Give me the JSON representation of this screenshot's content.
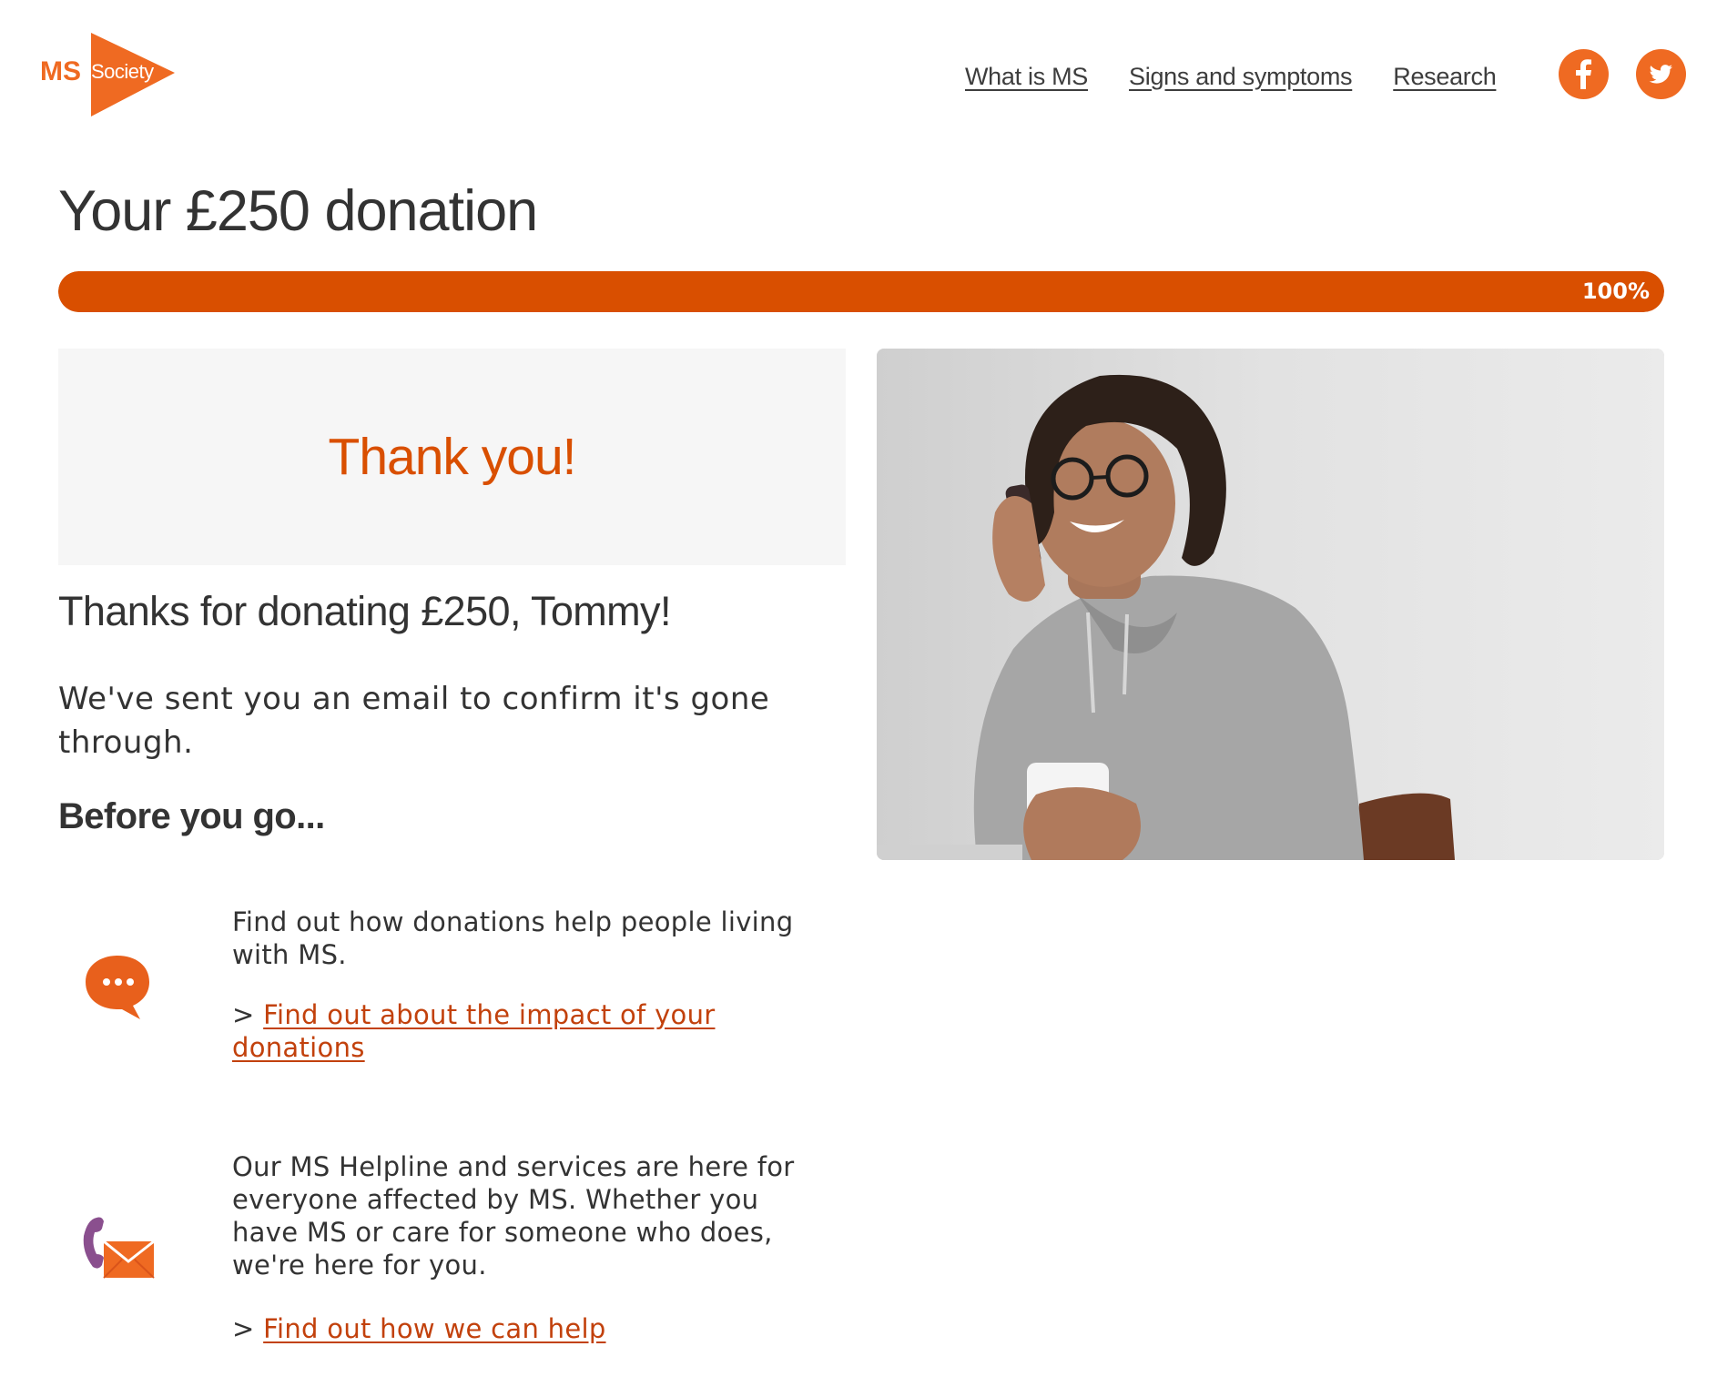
{
  "brand": {
    "logo_ms": "MS",
    "logo_society": "Society",
    "accent": "#d94f00",
    "link_color": "#c2410c"
  },
  "nav": {
    "items": [
      "What is MS",
      "Signs and symptoms",
      "Research"
    ]
  },
  "social": {
    "facebook_icon": "facebook-icon",
    "twitter_icon": "twitter-icon",
    "color": "#ef6a22"
  },
  "page": {
    "title": "Your £250 donation"
  },
  "progress": {
    "percent": 100,
    "label": "100%"
  },
  "thank_you": {
    "title": "Thank you!",
    "heading": "Thanks for donating £250, Tommy!",
    "confirm": "We've sent you an email to confirm it's gone through.",
    "before": "Before you go..."
  },
  "items": [
    {
      "icon": "speech-bubble-icon",
      "text": "Find out how donations help people living with MS.",
      "link_prefix": ">",
      "link": "Find out about the impact of your donations"
    },
    {
      "icon": "phone-envelope-icon",
      "text": "Our MS Helpline and services are here for everyone affected by MS. Whether you have MS or care for someone who does, we're here for you.",
      "link_prefix": ">",
      "link": "Find out how we can help"
    }
  ]
}
